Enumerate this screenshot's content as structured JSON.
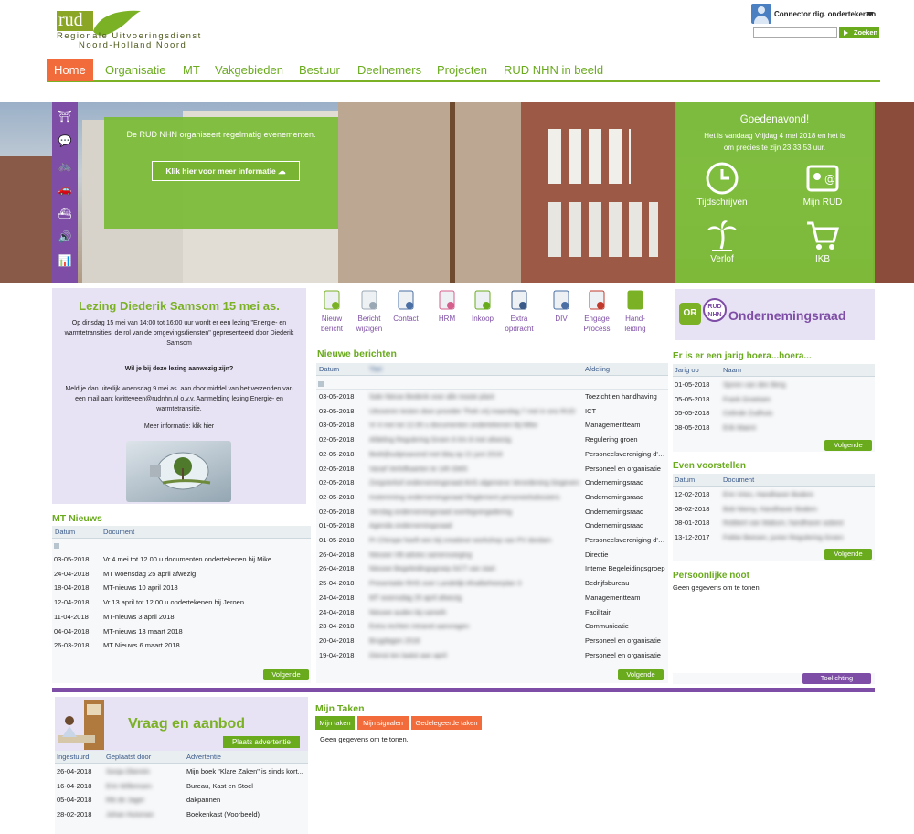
{
  "header": {
    "logo_text": "rud",
    "logo_sub_line1": "Regionale Uitvoeringsdienst",
    "logo_sub_line2": "Noord-Holland Noord",
    "user_name": "Connector dig. ondertekenen",
    "search_button": "Zoeken",
    "search_value": ""
  },
  "nav": [
    "Home",
    "Organisatie",
    "MT",
    "Vakgebieden",
    "Bestuur",
    "Deelnemers",
    "Projecten",
    "RUD NHN in beeld"
  ],
  "hero": {
    "side_icons": [
      "museum-icon",
      "chat-icon",
      "bicycle-icon",
      "car-icon",
      "boat-icon",
      "speaker-icon",
      "presentation-icon"
    ],
    "event_text": "De RUD NHN organiseert regelmatig evenementen.",
    "event_button": "Klik hier voor meer informatie",
    "greeting_title": "Goedenavond!",
    "greeting_line1": "Het is vandaag Vrijdag 4 mei 2018 en het is",
    "greeting_line2": "om precies te zijn 23:33:53 uur.",
    "tiles": [
      "Tijdschrijven",
      "Mijn RUD",
      "Verlof",
      "IKB"
    ],
    "accent": "#7bb125"
  },
  "lezing": {
    "title": "Lezing Diederik Samsom 15 mei as.",
    "p1": "Op dinsdag 15 mei van 14:00 tot 16:00 uur wordt er een lezing \"Energie- en warmtetransities: de rol van de omgevingsdiensten\" gepresenteerd door Diederik Samsom",
    "p2": "Wil je bij deze lezing aanwezig zijn?",
    "p3": "Meld je dan uiterlijk woensdag 9 mei as. aan door middel van het verzenden van een mail aan: kwitteveen@rudnhn.nl o.v.v. Aanmelding lezing Energie- en warmtetransitie.",
    "p4": "Meer informatie: klik hier"
  },
  "mt_nieuws": {
    "title": "MT Nieuws",
    "col_datum": "Datum",
    "col_document": "Document",
    "rows": [
      {
        "datum": "03-05-2018",
        "doc": "Vr 4 mei tot 12.00 u documenten ondertekenen bij Mike"
      },
      {
        "datum": "24-04-2018",
        "doc": "MT woensdag 25 april afwezig"
      },
      {
        "datum": "18-04-2018",
        "doc": "MT-nieuws 10 april 2018"
      },
      {
        "datum": "12-04-2018",
        "doc": "Vr 13 april tot 12.00 u ondertekenen bij Jeroen"
      },
      {
        "datum": "11-04-2018",
        "doc": "MT-nieuws 3 april 2018"
      },
      {
        "datum": "04-04-2018",
        "doc": "MT-nieuws 13 maart 2018"
      },
      {
        "datum": "26-03-2018",
        "doc": "MT Nieuws 6 maart 2018"
      }
    ],
    "more": "Volgende"
  },
  "quick_links": [
    {
      "l1": "Nieuw",
      "l2": "bericht"
    },
    {
      "l1": "Bericht",
      "l2": "wijzigen"
    },
    {
      "l1": "Contact",
      "l2": ""
    },
    {
      "l1": "HRM",
      "l2": ""
    },
    {
      "l1": "Inkoop",
      "l2": ""
    },
    {
      "l1": "Extra",
      "l2": "opdracht"
    },
    {
      "l1": "DIV",
      "l2": ""
    },
    {
      "l1": "Engage",
      "l2": "Process"
    },
    {
      "l1": "Hand-",
      "l2": "leiding"
    }
  ],
  "nieuwe_berichten": {
    "title": "Nieuwe berichten",
    "col_datum": "Datum",
    "col_titel": "Titel",
    "col_afdeling": "Afdeling",
    "rows": [
      {
        "datum": "03-05-2018",
        "titel": "Sale Nieuw Bedenk voor alle mooie plant",
        "afdeling": "Toezicht en handhaving"
      },
      {
        "datum": "03-05-2018",
        "titel": "Uitvoeren testen door provider Thek vrij maandag 7 mei in ons RUD",
        "afdeling": "ICT"
      },
      {
        "datum": "03-05-2018",
        "titel": "Vr 4 mei tot 12.00 u documenten ondertekenen bij Mike",
        "afdeling": "Managementteam"
      },
      {
        "datum": "02-05-2018",
        "titel": "Afdeling Regulering Groen 6 t/m 8 mei afwezig",
        "afdeling": "Regulering groen"
      },
      {
        "datum": "02-05-2018",
        "titel": "Bedrijfsuitjesavond met bbq op 21 juni 2018",
        "afdeling": "Personeelsvereniging d'Ampt"
      },
      {
        "datum": "02-05-2018",
        "titel": "Vanaf Verlofkaarten te 14h GMS",
        "afdeling": "Personeel en organisatie"
      },
      {
        "datum": "02-05-2018",
        "titel": "Zorgvierkof ondernemingsraad AVG algemene Verordening Gegevens",
        "afdeling": "Ondernemingsraad"
      },
      {
        "datum": "02-05-2018",
        "titel": "Instemming ondernemingsraad Reglement personeelsdossiers",
        "afdeling": "Ondernemingsraad"
      },
      {
        "datum": "02-05-2018",
        "titel": "Verslag ondernemingsraad overlegvergadering",
        "afdeling": "Ondernemingsraad"
      },
      {
        "datum": "01-05-2018",
        "titel": "Agenda ondernemingsraad",
        "afdeling": "Ondernemingsraad"
      },
      {
        "datum": "01-05-2018",
        "titel": "Pr Chirope heeft een bij creatieve workshop van PV dordam",
        "afdeling": "Personeelsvereniging d'Ampt"
      },
      {
        "datum": "26-04-2018",
        "titel": "Nieuwe VB-advies samenvoeging",
        "afdeling": "Directie"
      },
      {
        "datum": "26-04-2018",
        "titel": "Nieuwe Begeleidingsgroep GCT van start",
        "afdeling": "Interne Begeleidingsgroep"
      },
      {
        "datum": "25-04-2018",
        "titel": "Presentatie RHS over Landelijk Afvalbeheerplan 3",
        "afdeling": "Bedrijfsbureau"
      },
      {
        "datum": "24-04-2018",
        "titel": "MT woensdag 25 april afwezig",
        "afdeling": "Managementteam"
      },
      {
        "datum": "24-04-2018",
        "titel": "Nieuwe auden bij cameth",
        "afdeling": "Facilitair"
      },
      {
        "datum": "23-04-2018",
        "titel": "Extra rechten intranet aanvragen",
        "afdeling": "Communicatie"
      },
      {
        "datum": "20-04-2018",
        "titel": "Brugdagen 2018",
        "afdeling": "Personeel en organisatie"
      },
      {
        "datum": "19-04-2018",
        "titel": "Dienst ten laatst aan april",
        "afdeling": "Personeel en organisatie"
      }
    ],
    "more": "Volgende"
  },
  "ondernemingsraad": {
    "logo": "OR",
    "logo_small": "RUD NHN",
    "title": "Ondernemingsraad"
  },
  "jarig": {
    "title": "Er is er een jarig hoera...hoera...",
    "col_datum": "Jarig op",
    "col_naam": "Naam",
    "rows": [
      {
        "datum": "01-05-2018",
        "naam": "Sjoren van den Berg"
      },
      {
        "datum": "05-05-2018",
        "naam": "Frank Groetsen"
      },
      {
        "datum": "05-05-2018",
        "naam": "Celinde Zudhuis"
      },
      {
        "datum": "08-05-2018",
        "naam": "Erik Maent"
      }
    ],
    "more": "Volgende"
  },
  "voorstellen": {
    "title": "Even voorstellen",
    "col_datum": "Datum",
    "col_doc": "Document",
    "rows": [
      {
        "datum": "12-02-2018",
        "doc": "Erin Vries, Handhaver Bodem"
      },
      {
        "datum": "08-02-2018",
        "doc": "Bob Niemy, Handhaver Bodem"
      },
      {
        "datum": "08-01-2018",
        "doc": "Robbert van Mabum, handhaver asbest"
      },
      {
        "datum": "13-12-2017",
        "doc": "Fokke Beesen, junior Regulering Groen"
      }
    ],
    "more": "Volgende"
  },
  "notities": {
    "title": "Persoonlijke noot",
    "empty": "Geen gegevens om te tonen.",
    "button": "Toelichting"
  },
  "vraag": {
    "title": "Vraag en aanbod",
    "button": "Plaats advertentie",
    "col1": "Ingestuurd",
    "col2": "Geplaatst door",
    "col3": "Advertentie",
    "rows": [
      {
        "datum": "26-04-2018",
        "door": "Sonja Oberein",
        "adv": "Mijn boek \"Klare Zaken\" is sinds kort..."
      },
      {
        "datum": "16-04-2018",
        "door": "Erin Willemsen",
        "adv": "Bureau, Kast en Stoel"
      },
      {
        "datum": "05-04-2018",
        "door": "Rik de Jager",
        "adv": "dakpannen"
      },
      {
        "datum": "28-02-2018",
        "door": "Johan Huisman",
        "adv": "Boekenkast (Voorbeeld)"
      }
    ]
  },
  "taken": {
    "title": "Mijn Taken",
    "tabs": [
      "Mijn taken",
      "Mijn signalen",
      "Gedelegeerde taken"
    ],
    "empty": "Geen gegevens om te tonen."
  }
}
